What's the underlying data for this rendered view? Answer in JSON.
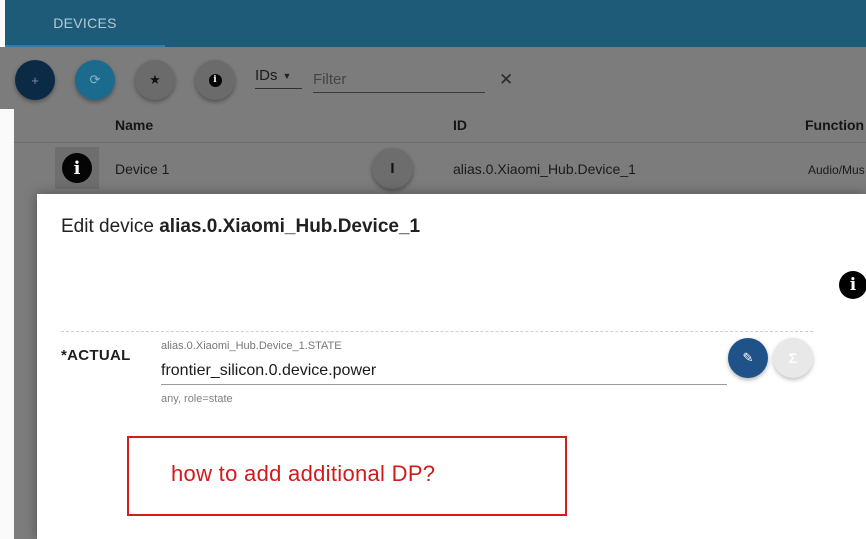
{
  "tabs": {
    "devices": "DEVICES"
  },
  "toolbar": {
    "add_icon": "+",
    "refresh_icon": "⟳",
    "star_icon": "★",
    "info_icon": "i",
    "ids_label": "IDs",
    "filter_placeholder": "Filter",
    "clear_icon": "✕"
  },
  "table": {
    "columns": [
      "Name",
      "ID",
      "Function"
    ],
    "rows": [
      {
        "name": "Device 1",
        "id": "alias.0.Xiaomi_Hub.Device_1",
        "function": "Audio/Mus"
      }
    ]
  },
  "dialog": {
    "title_prefix": "Edit device ",
    "title_device": "alias.0.Xiaomi_Hub.Device_1",
    "state": {
      "label": "*ACTUAL",
      "id": "alias.0.Xiaomi_Hub.Device_1.STATE",
      "value": "frontier_silicon.0.device.power",
      "hint": "any, role=state"
    }
  },
  "annotation": {
    "text": "how to add additional DP?"
  },
  "colors": {
    "topbar": "#1e5b79",
    "annotation": "#d31d1d",
    "edit_button": "#1f5288"
  }
}
